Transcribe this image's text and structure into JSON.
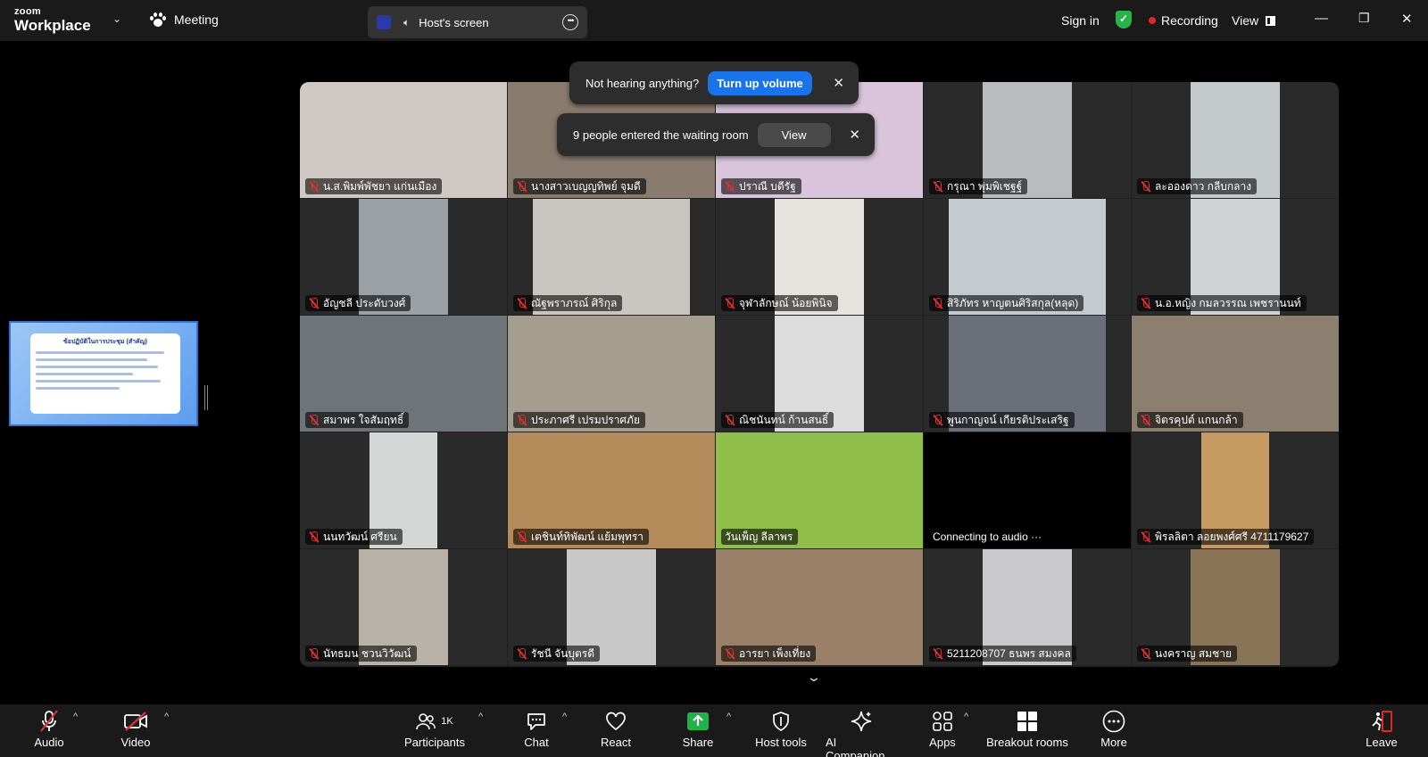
{
  "app": {
    "brand_top": "zoom",
    "brand_bottom": "Workplace",
    "meeting_label": "Meeting",
    "host_screen_label": "Host's screen",
    "sign_in": "Sign in",
    "recording": "Recording",
    "view": "View"
  },
  "banners": {
    "audio_prompt": "Not hearing anything?",
    "audio_button": "Turn up volume",
    "waiting_room": "9 people entered the waiting room",
    "waiting_button": "View"
  },
  "share": {
    "thumb_title": "ข้อปฏิบัติในการประชุม (สำคัญ)"
  },
  "tiles": [
    {
      "name": "น.ส.พิมพ์พัชยา แก่นเมือง",
      "muted": true,
      "bg": "#cfc8c4"
    },
    {
      "name": "นางสาวเบญญทิพย์ จุมดี",
      "muted": true,
      "bg": "#8a7b6f"
    },
    {
      "name": "ปราณี บดีรัฐ",
      "muted": true,
      "bg": "#d9c4dc"
    },
    {
      "name": "กรุณา พุ่มพิเชฐฐ์",
      "muted": true,
      "bg": "#b9bcbf"
    },
    {
      "name": "ละอองดาว กลีบกลาง",
      "muted": true,
      "bg": "#c4c9cc"
    },
    {
      "name": "อัญชลี ประดับวงศ์",
      "muted": true,
      "bg": "#9aa0a4"
    },
    {
      "name": "ณัฐพราภรณ์ ศิริกุล",
      "muted": true,
      "bg": "#c9c6c2"
    },
    {
      "name": "จุฬาลักษณ์ น้อยพินิจ",
      "muted": true,
      "bg": "#e6e3de"
    },
    {
      "name": "สิริภัทร หาญตนศิริสกุล(หลุด)",
      "muted": true,
      "bg": "#c3cbd0"
    },
    {
      "name": "น.อ.หญิง กมลวรรณ เพชรานนท์",
      "muted": true,
      "bg": "#cfd3d5"
    },
    {
      "name": "สมาพร ใจสัมฤทธิ์",
      "muted": true,
      "bg": "#6f7478"
    },
    {
      "name": "ประภาศรี เปรมปราศภัย",
      "muted": true,
      "bg": "#a59e8e"
    },
    {
      "name": "ณิชนันทน์ ก้านสนธิ์",
      "muted": true,
      "bg": "#dcdcdc"
    },
    {
      "name": "พูนกาญจน์ เกียรติประเสริฐ",
      "muted": true,
      "bg": "#6b6f7a"
    },
    {
      "name": "จิตรคุปต์ แกนกล้า",
      "muted": true,
      "bg": "#8d7f70"
    },
    {
      "name": "นนทวัฒน์ ศรียน",
      "muted": true,
      "bg": "#d4d6d6"
    },
    {
      "name": "เตชินท์ทิพัฒน์ แย้มพุทรา",
      "muted": true,
      "bg": "#b58a5a"
    },
    {
      "name": "วันเพ็ญ ลีลาพร",
      "muted": false,
      "bg": "#8fbf4a"
    },
    {
      "name": "Connecting to audio ···",
      "muted": false,
      "bg": "#000000"
    },
    {
      "name": "พิรลลิตา ลอยพงศ์ศรี 4711179627",
      "muted": true,
      "bg": "#c79a62"
    },
    {
      "name": "นัทธมน ชวนวิวัฒน์",
      "muted": true,
      "bg": "#b9b2a8"
    },
    {
      "name": "รัชนี จันบุตรดี",
      "muted": true,
      "bg": "#c8c8c8"
    },
    {
      "name": "อารยา เพ็งเที่ยง",
      "muted": true,
      "bg": "#9a8068"
    },
    {
      "name": "5211208707 ธนพร สมงคล",
      "muted": true,
      "bg": "#c9c9cb"
    },
    {
      "name": "นงคราญ สมชาย",
      "muted": true,
      "bg": "#8a7458"
    }
  ],
  "toolbar": {
    "audio": "Audio",
    "video": "Video",
    "participants": "Participants",
    "participants_count": "1K",
    "chat": "Chat",
    "react": "React",
    "share": "Share",
    "host_tools": "Host tools",
    "ai_companion": "AI Companion",
    "apps": "Apps",
    "breakout_rooms": "Breakout rooms",
    "more": "More",
    "leave": "Leave"
  }
}
